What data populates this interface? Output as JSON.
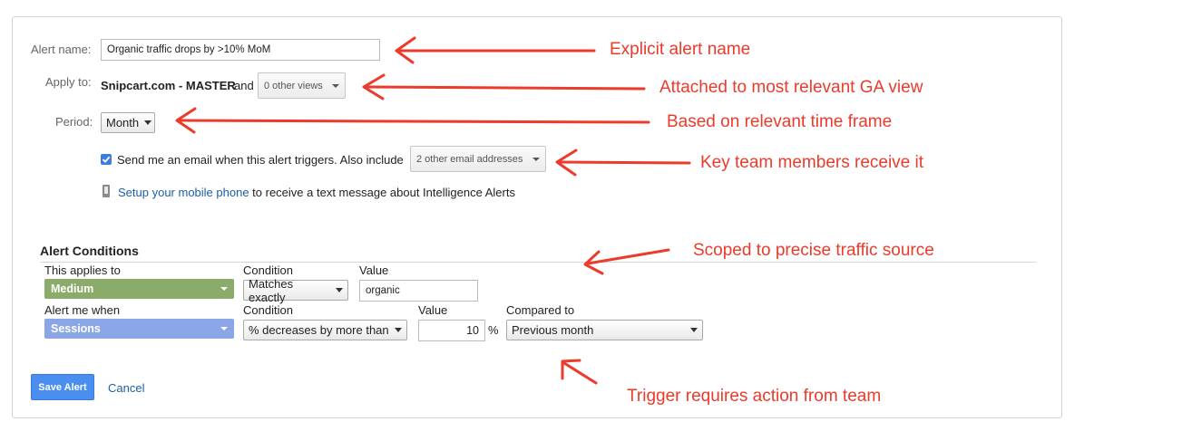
{
  "form": {
    "alert_name_label": "Alert name:",
    "alert_name_value": "Organic traffic drops by  >10% MoM",
    "apply_to_label": "Apply to:",
    "apply_to_view": "Snipcart.com - MASTER",
    "apply_to_and": "and",
    "other_views_button": "0 other views",
    "period_label": "Period:",
    "period_value": "Month",
    "email_checkbox_checked": true,
    "email_text": "Send me an email when this alert triggers. Also include",
    "other_emails_button": "2 other email addresses",
    "mobile_link": "Setup your mobile phone",
    "mobile_text": "to receive a text message about Intelligence Alerts"
  },
  "conditions": {
    "title": "Alert Conditions",
    "row1": {
      "applies_header": "This applies to",
      "condition_header": "Condition",
      "value_header": "Value",
      "dimension": "Medium",
      "condition": "Matches exactly",
      "value": "organic"
    },
    "row2": {
      "alert_when_header": "Alert me when",
      "condition_header": "Condition",
      "value_header": "Value",
      "compared_header": "Compared to",
      "metric": "Sessions",
      "condition": "% decreases by more than",
      "value": "10",
      "percent": "%",
      "compared": "Previous month"
    }
  },
  "actions": {
    "save": "Save Alert",
    "cancel": "Cancel"
  },
  "annotations": {
    "name": "Explicit alert name",
    "view": "Attached to most relevant GA view",
    "period": "Based on relevant time frame",
    "team": "Key team members receive it",
    "source": "Scoped to precise traffic source",
    "trigger": "Trigger requires action from team"
  },
  "colors": {
    "annotation": "#ec3a2b",
    "dimension_pill": "#8bab6a",
    "metric_pill": "#8aa6e6",
    "save_button": "#4a8ef0",
    "link": "#1a5fa8"
  }
}
